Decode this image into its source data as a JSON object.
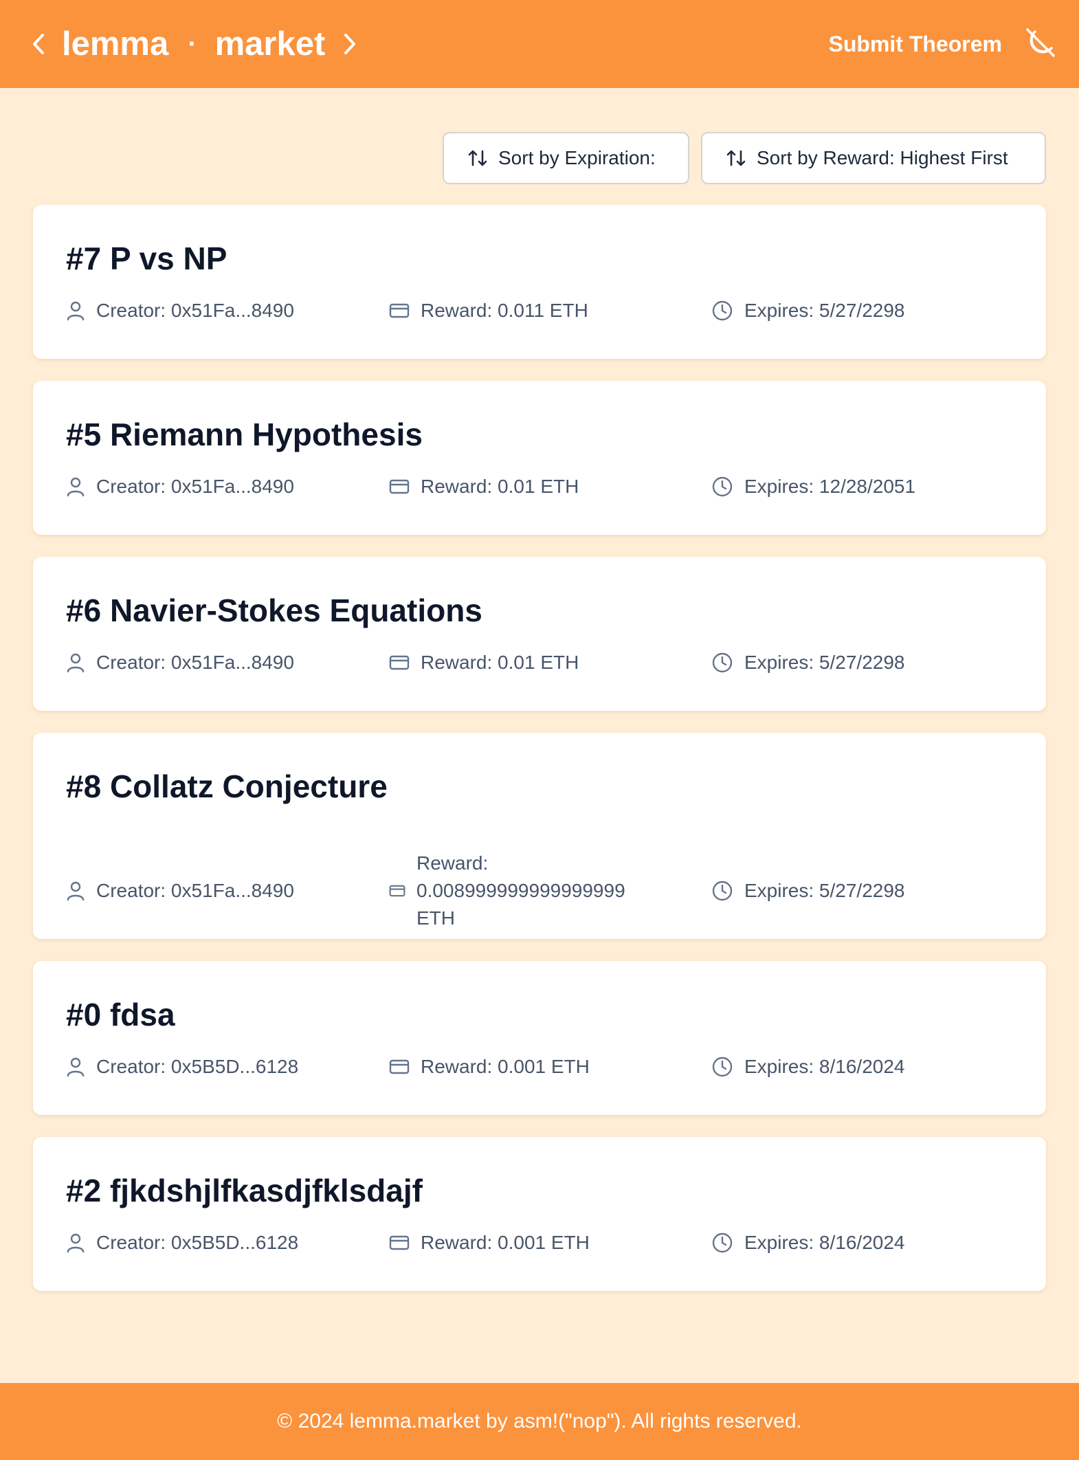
{
  "header": {
    "brand_left": "lemma",
    "brand_separator": "·",
    "brand_right": "market",
    "submit_label": "Submit Theorem",
    "icons": {
      "prev": "chevron-left-icon",
      "next": "chevron-right-icon",
      "theme": "moon-off-icon"
    }
  },
  "sort": {
    "expiration_label": "Sort by Expiration:",
    "reward_label": "Sort by Reward: Highest First",
    "icon": "arrow-up-down-icon"
  },
  "theorems": [
    {
      "title": "#7 P vs NP",
      "creator": "Creator: 0x51Fa...8490",
      "reward": "Reward: 0.011 ETH",
      "expires": "Expires: 5/27/2298"
    },
    {
      "title": "#5 Riemann Hypothesis",
      "creator": "Creator: 0x51Fa...8490",
      "reward": "Reward: 0.01 ETH",
      "expires": "Expires: 12/28/2051"
    },
    {
      "title": "#6 Navier-Stokes Equations",
      "creator": "Creator: 0x51Fa...8490",
      "reward": "Reward: 0.01 ETH",
      "expires": "Expires: 5/27/2298"
    },
    {
      "title": "#8 Collatz Conjecture",
      "creator": "Creator: 0x51Fa...8490",
      "reward": "Reward: 0.008999999999999999 ETH",
      "expires": "Expires: 5/27/2298"
    },
    {
      "title": "#0 fdsa",
      "creator": "Creator: 0x5B5D...6128",
      "reward": "Reward: 0.001 ETH",
      "expires": "Expires: 8/16/2024"
    },
    {
      "title": "#2 fjkdshjlfkasdjfklsdajf",
      "creator": "Creator: 0x5B5D...6128",
      "reward": "Reward: 0.001 ETH",
      "expires": "Expires: 8/16/2024"
    }
  ],
  "footer": {
    "text": "© 2024 lemma.market by asm!(\"nop\"). All rights reserved."
  },
  "colors": {
    "accent": "#fb923c",
    "background": "#ffedd5",
    "card": "#ffffff",
    "title_text": "#0f172a",
    "meta_text": "#475569"
  }
}
